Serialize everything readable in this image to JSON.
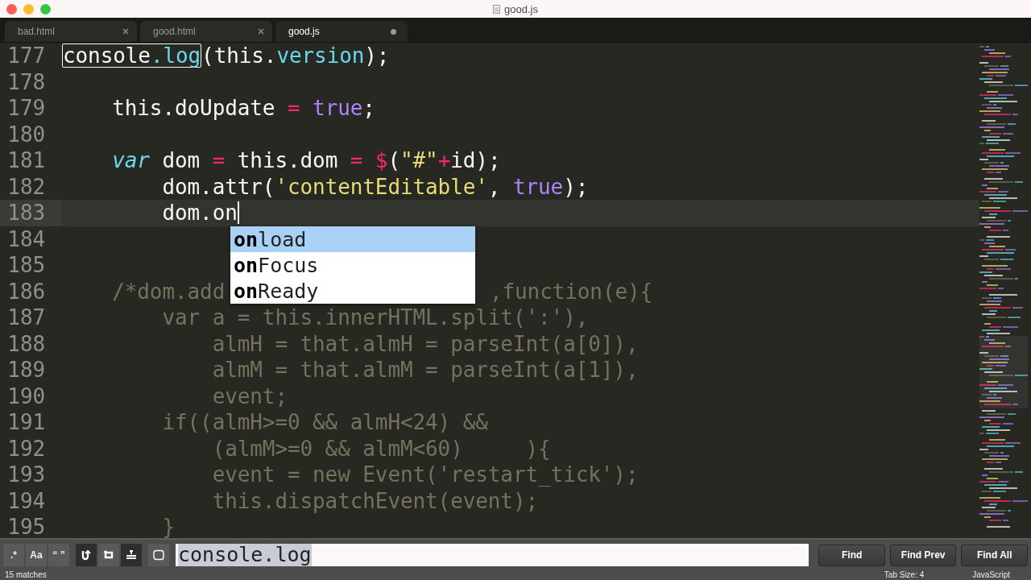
{
  "window": {
    "title": "good.js"
  },
  "tabs": [
    {
      "label": "bad.html",
      "selected": false,
      "modified": false
    },
    {
      "label": "good.html",
      "selected": false,
      "modified": false
    },
    {
      "label": "good.js",
      "selected": true,
      "modified": true
    }
  ],
  "editor": {
    "lines": [
      {
        "number": "177",
        "current": false,
        "tokens": [
          {
            "kind": "match",
            "parts": [
              {
                "text": "console",
                "kind": "plain"
              },
              {
                "text": ".log",
                "kind": "support"
              }
            ]
          },
          {
            "text": "(this.",
            "kind": "plain"
          },
          {
            "text": "version",
            "kind": "support"
          },
          {
            "text": ");",
            "kind": "plain"
          }
        ]
      },
      {
        "number": "178",
        "current": false
      },
      {
        "number": "179",
        "current": false,
        "tokens": [
          {
            "text": "    this.doUpdate ",
            "kind": "plain"
          },
          {
            "text": "= ",
            "kind": "keyword"
          },
          {
            "text": "true",
            "kind": "constant"
          },
          {
            "text": ";",
            "kind": "plain"
          }
        ]
      },
      {
        "number": "180",
        "current": false
      },
      {
        "number": "181",
        "current": false,
        "tokens": [
          {
            "text": "    var",
            "kind": "storage"
          },
          {
            "text": " dom ",
            "kind": "plain"
          },
          {
            "text": "=",
            "kind": "keyword"
          },
          {
            "text": " this.dom ",
            "kind": "plain"
          },
          {
            "text": "= $",
            "kind": "keyword"
          },
          {
            "text": "(",
            "kind": "plain"
          },
          {
            "text": "\"#\"",
            "kind": "string"
          },
          {
            "text": "+",
            "kind": "keyword"
          },
          {
            "text": "id);",
            "kind": "plain"
          }
        ]
      },
      {
        "number": "182",
        "current": false,
        "tokens": [
          {
            "text": "        dom.attr(",
            "kind": "plain"
          },
          {
            "text": "'contentEditable'",
            "kind": "string"
          },
          {
            "text": ", ",
            "kind": "plain"
          },
          {
            "text": "true",
            "kind": "constant"
          },
          {
            "text": ");",
            "kind": "plain"
          }
        ]
      },
      {
        "number": "183",
        "current": true,
        "tokens": [
          {
            "text": "        dom.on",
            "kind": "plain"
          },
          {
            "kind": "cursor"
          }
        ]
      },
      {
        "number": "184",
        "current": false
      },
      {
        "number": "185",
        "current": false
      },
      {
        "number": "186",
        "current": false,
        "tokens": [
          {
            "text": "    /*dom.add",
            "kind": "comment"
          },
          {
            "kind": "covered"
          },
          {
            "text": ",function(e){",
            "kind": "comment"
          }
        ]
      },
      {
        "number": "187",
        "current": false,
        "tokens": [
          {
            "text": "        var a = this.innerHTML.split(':'),",
            "kind": "comment"
          }
        ]
      },
      {
        "number": "188",
        "current": false,
        "tokens": [
          {
            "text": "            almH = that.almH = parseInt(a[0]),",
            "kind": "comment"
          }
        ]
      },
      {
        "number": "189",
        "current": false,
        "tokens": [
          {
            "text": "            almM = that.almM = parseInt(a[1]),",
            "kind": "comment"
          }
        ]
      },
      {
        "number": "190",
        "current": false,
        "tokens": [
          {
            "text": "            event;",
            "kind": "comment"
          }
        ]
      },
      {
        "number": "191",
        "current": false,
        "tokens": [
          {
            "text": "        if((almH>=0 && almH<24) &&",
            "kind": "comment"
          }
        ]
      },
      {
        "number": "192",
        "current": false,
        "tokens": [
          {
            "text": "            (almM>=0 && almM<60)     ){",
            "kind": "comment"
          }
        ]
      },
      {
        "number": "193",
        "current": false,
        "tokens": [
          {
            "text": "            event = new Event('restart_tick');",
            "kind": "comment"
          }
        ]
      },
      {
        "number": "194",
        "current": false,
        "tokens": [
          {
            "text": "            this.dispatchEvent(event);",
            "kind": "comment"
          }
        ]
      },
      {
        "number": "195",
        "current": false,
        "tokens": [
          {
            "text": "        }",
            "kind": "comment"
          }
        ]
      }
    ]
  },
  "autocomplete": [
    {
      "text": "**on**load",
      "selected": true
    },
    {
      "text": "**on**Focus",
      "selected": false
    },
    {
      "text": "**on**Ready",
      "selected": false
    }
  ],
  "find_panel": {
    "options": [
      {
        "kind": "text",
        "label": ".*",
        "on": false
      },
      {
        "kind": "text",
        "label": "Aa",
        "on": false
      },
      {
        "kind": "text",
        "label": "“ ”",
        "on": false
      },
      {
        "kind": "wrap",
        "on": true
      },
      {
        "kind": "selection",
        "on": false
      },
      {
        "kind": "highlight",
        "on": true
      },
      {
        "kind": "panel",
        "on": false
      }
    ],
    "value": "console.log",
    "buttons": [
      "Find",
      "Find Prev",
      "Find All"
    ]
  },
  "status_bar": {
    "left": "15 matches",
    "tab_size": "Tab Size: 4",
    "syntax": "JavaScript"
  }
}
